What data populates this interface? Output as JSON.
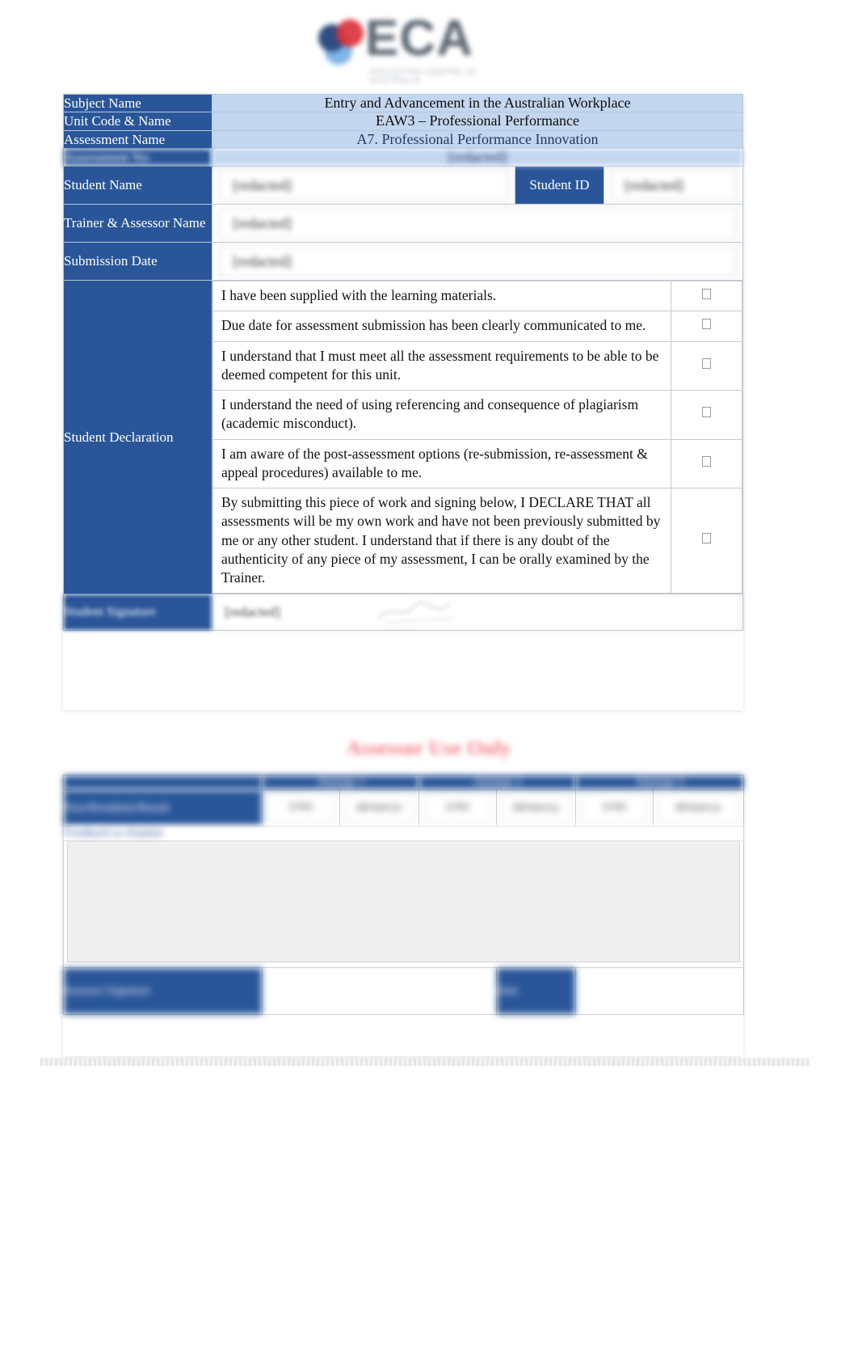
{
  "logo": {
    "text": "ECA",
    "subtext": "EDUCATION CENTRE OF AUSTRALIA",
    "mark_colors": {
      "dark_blue": "#1d3f78",
      "red": "#d8222c",
      "light_blue": "#63a6df"
    }
  },
  "colors": {
    "header_blue": "#2a5699",
    "value_blue": "#c3d6ef",
    "accent_navy": "#1f3864",
    "assessor_heading_red": "#f4777f"
  },
  "cover": {
    "rows": [
      {
        "label": "Subject Name",
        "value": "Entry and Advancement in the Australian Workplace"
      },
      {
        "label": "Unit Code & Name",
        "value": "EAW3  – Professional Performance"
      },
      {
        "label": "Assessment Name",
        "value": "A7. Professional Performance Innovation"
      },
      {
        "label": "Assessment No",
        "value": "[redacted]"
      }
    ],
    "student_name": {
      "label": "Student Name",
      "value": "[redacted]"
    },
    "student_id": {
      "label": "Student ID",
      "value": "[redacted]"
    },
    "trainer": {
      "label": "Trainer & Assessor Name",
      "value": "[redacted]"
    },
    "submission_date": {
      "label": "Submission Date",
      "value": "[redacted]"
    }
  },
  "declaration": {
    "label": "Student Declaration",
    "items": [
      "I have been supplied with the learning materials.",
      "Due date for assessment submission has been clearly communicated to me.",
      "I understand that I must meet all the assessment requirements to be able to be deemed competent for this unit.",
      "I understand the need of using referencing and consequence of plagiarism (academic misconduct).",
      "I am aware of the post-assessment options (re-submission, re-assessment & appeal procedures) available to me.",
      "By submitting this piece of work and signing below, I DECLARE THAT all assessments will be my own work and have not been previously submitted by me or any other student. I understand that if there is any doubt of the authenticity of any piece of my assessment, I can be orally examined by the Trainer."
    ],
    "checkbox_glyph": "☐",
    "checked": [
      true,
      true,
      true,
      true,
      true,
      true
    ]
  },
  "student_signature": {
    "label": "Student Signature",
    "value": "[redacted]"
  },
  "assessor": {
    "heading": "Assessor Use Only",
    "columns": [
      "Attempt 1",
      "Attempt 2",
      "Attempt 3"
    ],
    "subcolumns": [
      "S/NS",
      "Date"
    ],
    "result_row_label": "Pass/Resubmit/Result",
    "cells": [
      [
        "S/NS",
        "dd/mm/yy"
      ],
      [
        "S/NS",
        "dd/mm/yy"
      ],
      [
        "S/NS",
        "dd/mm/yy"
      ]
    ],
    "feedback_label": "Feedback to Student",
    "feedback_value": "",
    "signature_label": "Assessor Signature",
    "signature_value": "",
    "date_label": "Date",
    "date_value": ""
  }
}
